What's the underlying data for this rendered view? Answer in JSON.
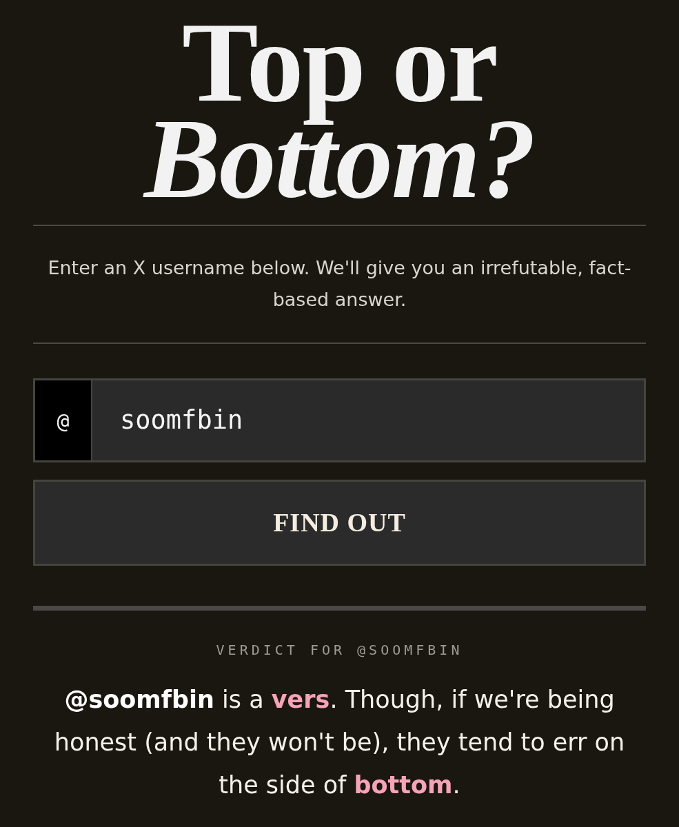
{
  "title": "Top or *Bottom?*",
  "intro": "Enter an X username below. We'll give you an irrefutable, fact-based answer.",
  "username_field": {
    "prefix": "@",
    "value": "soomfbin"
  },
  "submit_button": "FIND OUT",
  "verdict": {
    "heading": "VERDICT FOR @SOOMFBIN",
    "segments": [
      {
        "kind": "handle",
        "text": "@soomfbin"
      },
      {
        "kind": "plain",
        "text": " is a "
      },
      {
        "kind": "role",
        "text": "vers"
      },
      {
        "kind": "plain",
        "text": ". Though, if we're being honest (and they won't be), they tend to err on the side of "
      },
      {
        "kind": "role",
        "text": "bottom"
      },
      {
        "kind": "plain",
        "text": "."
      }
    ]
  }
}
